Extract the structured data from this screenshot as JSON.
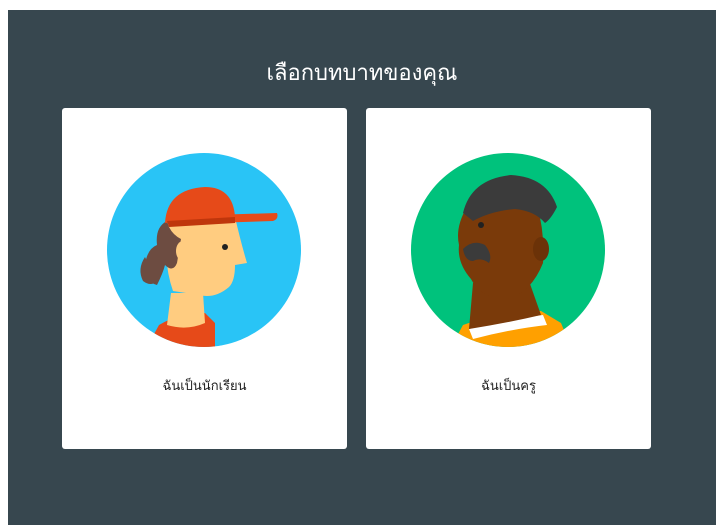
{
  "dialog": {
    "title": "เลือกบทบาทของคุณ"
  },
  "roles": [
    {
      "label": "ฉันเป็นนักเรียน",
      "avatar_icon": "student-avatar-icon",
      "circle_color": "#29c4f6"
    },
    {
      "label": "ฉันเป็นครู",
      "avatar_icon": "teacher-avatar-icon",
      "circle_color": "#00c27c"
    }
  ]
}
